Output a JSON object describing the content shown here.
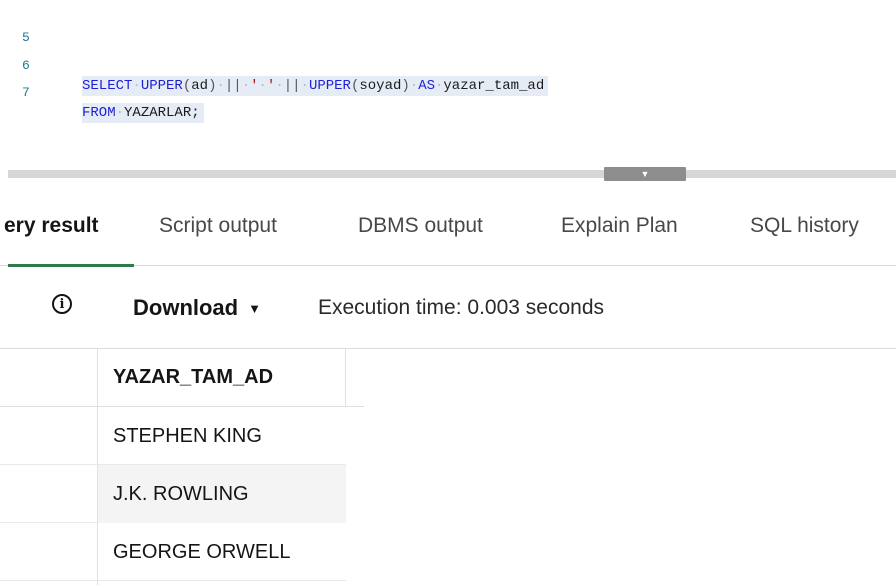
{
  "editor": {
    "lines": [
      {
        "number": "5",
        "tokens": []
      },
      {
        "number": "6",
        "tokens": [
          {
            "t": "SELECT",
            "c": "kw"
          },
          {
            "t": "·",
            "c": "ws"
          },
          {
            "t": "UPPER",
            "c": "fn"
          },
          {
            "t": "(",
            "c": "op"
          },
          {
            "t": "ad",
            "c": "id"
          },
          {
            "t": ")",
            "c": "op"
          },
          {
            "t": "·",
            "c": "ws"
          },
          {
            "t": "||",
            "c": "op"
          },
          {
            "t": "·",
            "c": "ws"
          },
          {
            "t": "'",
            "c": "str"
          },
          {
            "t": "·",
            "c": "ws"
          },
          {
            "t": "'",
            "c": "str"
          },
          {
            "t": "·",
            "c": "ws"
          },
          {
            "t": "||",
            "c": "op"
          },
          {
            "t": "·",
            "c": "ws"
          },
          {
            "t": "UPPER",
            "c": "fn"
          },
          {
            "t": "(",
            "c": "op"
          },
          {
            "t": "soyad",
            "c": "id"
          },
          {
            "t": ")",
            "c": "op"
          },
          {
            "t": "·",
            "c": "ws"
          },
          {
            "t": "AS",
            "c": "kw"
          },
          {
            "t": "·",
            "c": "ws"
          },
          {
            "t": "yazar_tam_ad",
            "c": "id"
          }
        ]
      },
      {
        "number": "7",
        "tokens": [
          {
            "t": "FROM",
            "c": "kw"
          },
          {
            "t": "·",
            "c": "ws"
          },
          {
            "t": "YAZARLAR;",
            "c": "id"
          }
        ]
      }
    ]
  },
  "tabs": [
    {
      "label": "ery result",
      "active": true
    },
    {
      "label": "Script output",
      "active": false
    },
    {
      "label": "DBMS output",
      "active": false
    },
    {
      "label": "Explain Plan",
      "active": false
    },
    {
      "label": "SQL history",
      "active": false
    }
  ],
  "toolbar": {
    "info_icon_glyph": "i",
    "download_label": "Download",
    "download_caret": "▼",
    "execution_time": "Execution time: 0.003 seconds"
  },
  "splitter": {
    "handle_glyph": "▼"
  },
  "grid": {
    "columns": [
      "YAZAR_TAM_AD"
    ],
    "rows": [
      "STEPHEN KING",
      "J.K. ROWLING",
      "GEORGE ORWELL"
    ]
  },
  "colors": {
    "keyword": "#1f1fd6",
    "active_tab_underline": "#2f7a4a",
    "code_highlight": "#e6ecf5"
  }
}
